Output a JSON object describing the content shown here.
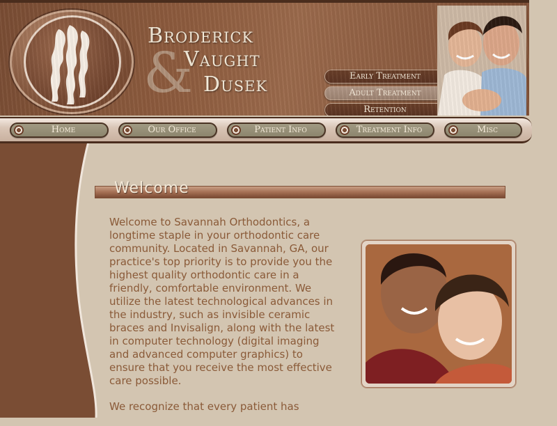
{
  "brand": {
    "line1": "Broderick",
    "line2": "Vaught",
    "ampersand": "&",
    "line3": "Dusek"
  },
  "quick_links": [
    {
      "label": "Early Treatment"
    },
    {
      "label": "Adult Treatment"
    },
    {
      "label": "Retention"
    }
  ],
  "nav": [
    {
      "label": "Home"
    },
    {
      "label": "Our Office"
    },
    {
      "label": "Patient Info"
    },
    {
      "label": "Treatment Info"
    },
    {
      "label": "Misc"
    }
  ],
  "main": {
    "section_title": "Welcome",
    "paragraph1": "Welcome to Savannah Orthodontics, a longtime staple in your orthodontic care community. Located in Savannah, GA, our practice's top priority is to provide you the highest quality orthodontic care in a friendly, comfortable environment. We utilize the latest technological advances in the industry, such as invisible ceramic braces and Invisalign, along with the latest in computer technology (digital imaging and advanced computer graphics) to ensure that you receive the most effective care possible.",
    "paragraph2": "We recognize that every patient has"
  },
  "colors": {
    "page_bg": "#d3c5b1",
    "sidebar_brown": "#7a4d34",
    "text_brown": "#8a5a38",
    "header_dark": "#4a2d1d"
  }
}
